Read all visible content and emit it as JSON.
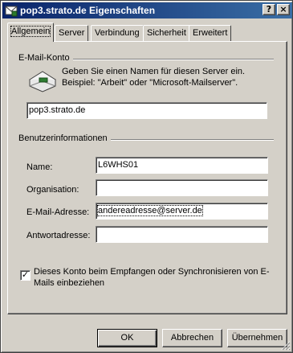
{
  "window": {
    "title": "pop3.strato.de Eigenschaften",
    "help_glyph": "?",
    "close_glyph": "×"
  },
  "tabs": [
    {
      "label": "Allgemein",
      "active": true
    },
    {
      "label": "Server",
      "active": false
    },
    {
      "label": "Verbindung",
      "active": false
    },
    {
      "label": "Sicherheit",
      "active": false
    },
    {
      "label": "Erweitert",
      "active": false
    }
  ],
  "email_account": {
    "group_label": "E-Mail-Konto",
    "description": "Geben Sie einen Namen für diesen Server ein. Beispiel: \"Arbeit\" oder \"Microsoft-Mailserver\".",
    "account_name": "pop3.strato.de"
  },
  "user_info": {
    "group_label": "Benutzerinformationen",
    "fields": [
      {
        "label": "Name:",
        "value": "L6WHS01"
      },
      {
        "label": "Organisation:",
        "value": ""
      },
      {
        "label": "E-Mail-Adresse:",
        "value": "andereadresse@server.de"
      },
      {
        "label": "Antwortadresse:",
        "value": ""
      }
    ]
  },
  "include_account": {
    "checked": true,
    "check_glyph": "✓",
    "label": "Dieses Konto beim Empfangen oder Synchronisieren von E-Mails einbeziehen"
  },
  "buttons": {
    "ok": "OK",
    "cancel": "Abbrechen",
    "apply": "Übernehmen"
  },
  "colors": {
    "title_start": "#0a246a",
    "title_end": "#3a6ea5",
    "face": "#d4d0c8"
  }
}
